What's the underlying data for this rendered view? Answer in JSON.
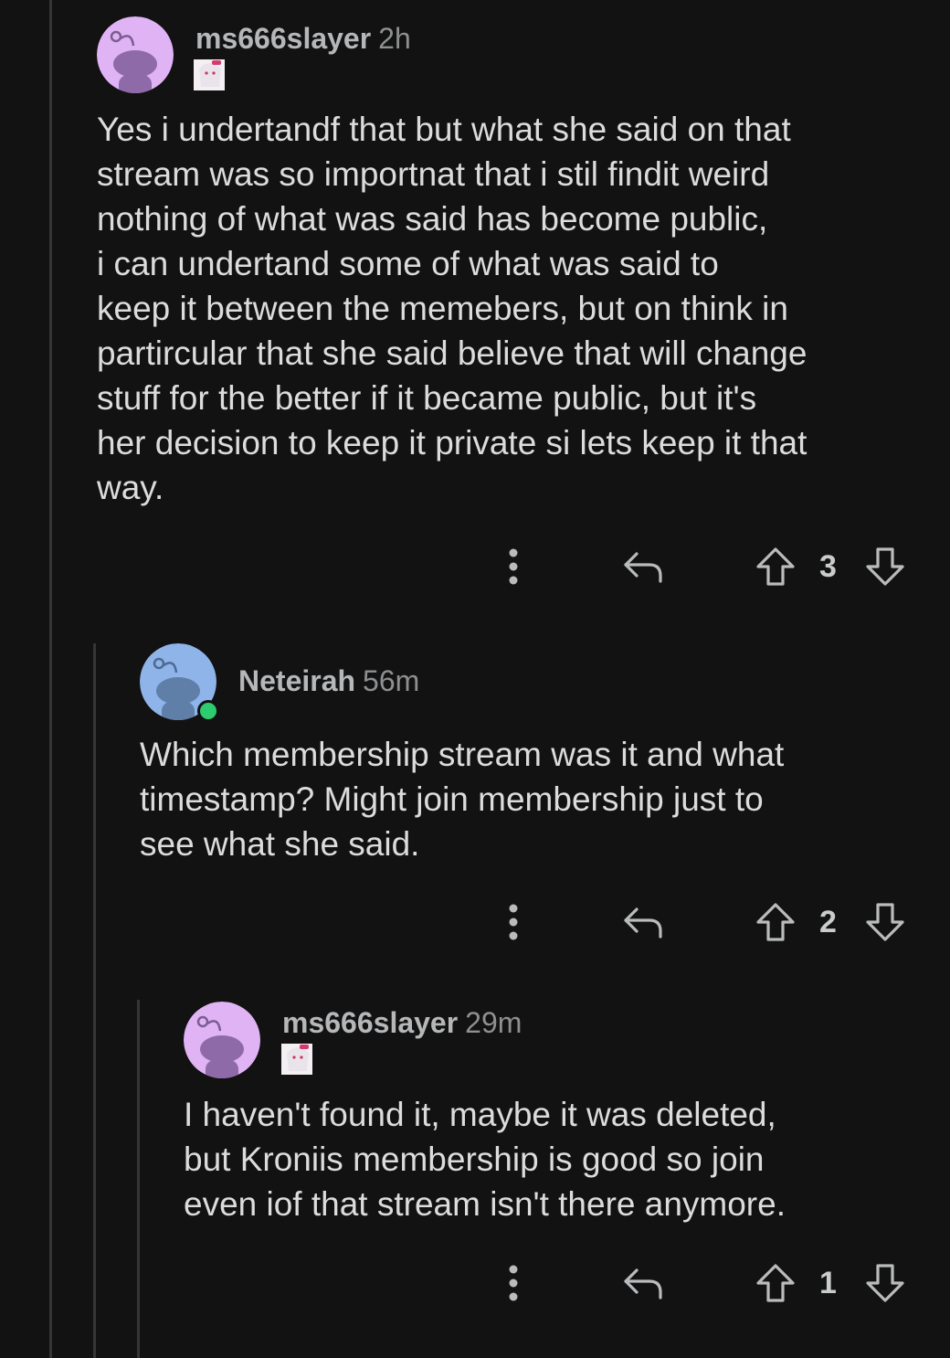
{
  "comments": [
    {
      "username": "ms666slayer",
      "time": "2h",
      "avatar_color": "#e0b3f5",
      "body": "Yes i undertandf that but what she said on that\nstream was so importnat that i stil findit weird\nnothing of what was said has become public,\ni can undertand some of what was said to\nkeep it between the memebers, but on think in\npartircular that she said believe that will change\nstuff for the better if it became public, but it's\nher decision to keep it private si lets keep it that\nway.",
      "score": "3"
    },
    {
      "username": "Neteirah",
      "time": "56m",
      "avatar_color": "#8fb4ea",
      "online": true,
      "body": "Which membership stream was it and what\ntimestamp? Might join membership just to\nsee what she said.",
      "score": "2"
    },
    {
      "username": "ms666slayer",
      "time": "29m",
      "avatar_color": "#e0b3f5",
      "body": "I haven't found it, maybe it was deleted,\nbut Kroniis membership is good so join\neven iof that stream isn't there anymore.",
      "score": "1"
    }
  ],
  "icons": {
    "more": "more-vertical-icon",
    "reply": "reply-icon",
    "upvote": "upvote-arrow-icon",
    "downvote": "downvote-arrow-icon"
  },
  "colors": {
    "background": "#121212",
    "thread_line": "#343536",
    "online": "#2ecc71"
  }
}
